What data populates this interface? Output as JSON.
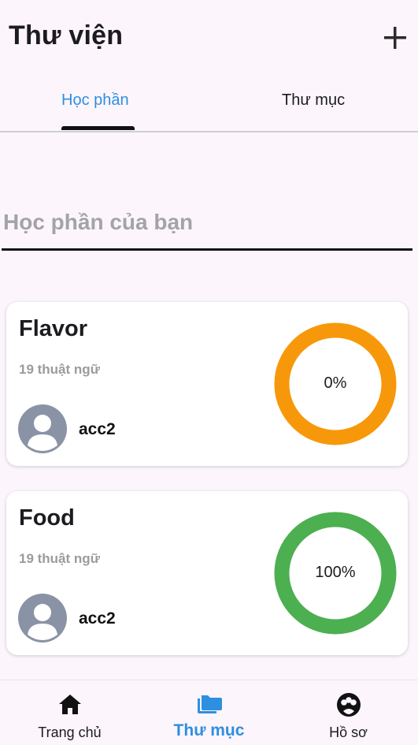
{
  "header": {
    "title": "Thư viện",
    "add_icon": "plus-icon"
  },
  "tabs": [
    {
      "label": "Học phần",
      "active": true
    },
    {
      "label": "Thư mục",
      "active": false
    }
  ],
  "search": {
    "placeholder": "Học phần của bạn",
    "value": ""
  },
  "cards": [
    {
      "name": "Flavor",
      "terms": "19 thuật ngữ",
      "user": "acc2",
      "progress_label": "0%",
      "progress": 0,
      "ring_color": "#f7980b"
    },
    {
      "name": "Food",
      "terms": "19 thuật ngữ",
      "user": "acc2",
      "progress_label": "100%",
      "progress": 100,
      "ring_color": "#4caf50"
    }
  ],
  "bottom_nav": [
    {
      "label": "Trang chủ",
      "icon": "home-icon",
      "active": false
    },
    {
      "label": "Thư mục",
      "icon": "folder-icon",
      "active": true
    },
    {
      "label": "Hồ sơ",
      "icon": "profile-icon",
      "active": false
    }
  ],
  "colors": {
    "accent": "#2e8fe0",
    "background": "#fcf5fc",
    "avatar": "#8a93a6"
  }
}
